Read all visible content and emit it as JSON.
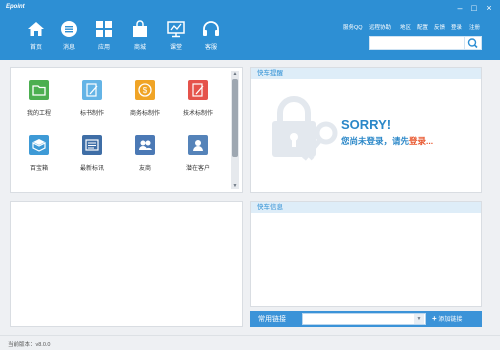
{
  "window": {
    "logo": "Epoint",
    "controls": [
      "–",
      "□",
      "×"
    ]
  },
  "nav": [
    {
      "label": "首页",
      "icon": "home-icon"
    },
    {
      "label": "消息",
      "icon": "message-icon"
    },
    {
      "label": "应用",
      "icon": "apps-grid-icon"
    },
    {
      "label": "商城",
      "icon": "shopping-bag-icon"
    },
    {
      "label": "课堂",
      "icon": "classroom-icon"
    },
    {
      "label": "客服",
      "icon": "headset-icon"
    }
  ],
  "top_links": [
    "服务QQ",
    "远程协助",
    "地区",
    "配置",
    "反馈",
    "登录",
    "注册"
  ],
  "search": {
    "placeholder": "",
    "icon": "search-icon"
  },
  "apps": [
    {
      "label": "我的工程",
      "icon": "folder-icon",
      "color": "#4caf50"
    },
    {
      "label": "标书制作",
      "icon": "edit-document-icon",
      "color": "#64b4e6"
    },
    {
      "label": "商务标制作",
      "icon": "coin-icon",
      "color": "#f0a426"
    },
    {
      "label": "技术标制作",
      "icon": "pencil-note-icon",
      "color": "#e5534b"
    },
    {
      "label": "百宝箱",
      "icon": "toolbox-icon",
      "color": "#3e9ad6"
    },
    {
      "label": "最新标讯",
      "icon": "news-icon",
      "color": "#3f6ea6"
    },
    {
      "label": "友商",
      "icon": "partners-icon",
      "color": "#4b79b5"
    },
    {
      "label": "潜在客户",
      "icon": "contact-icon",
      "color": "#5583b9"
    }
  ],
  "reminder": {
    "title": "快车提醒",
    "sorry": "SORRY!",
    "msg_prefix": "您尚未登录，请先",
    "msg_login": "登录",
    "msg_suffix": "..."
  },
  "info": {
    "title": "快车信息"
  },
  "links": {
    "label": "常用链接",
    "add_label": "添加链接"
  },
  "status": {
    "version": "当前版本：v8.0.0"
  },
  "colors": {
    "primary": "#2d8fd4",
    "accent": "#e8552c",
    "panel_head": "#deedf8"
  }
}
